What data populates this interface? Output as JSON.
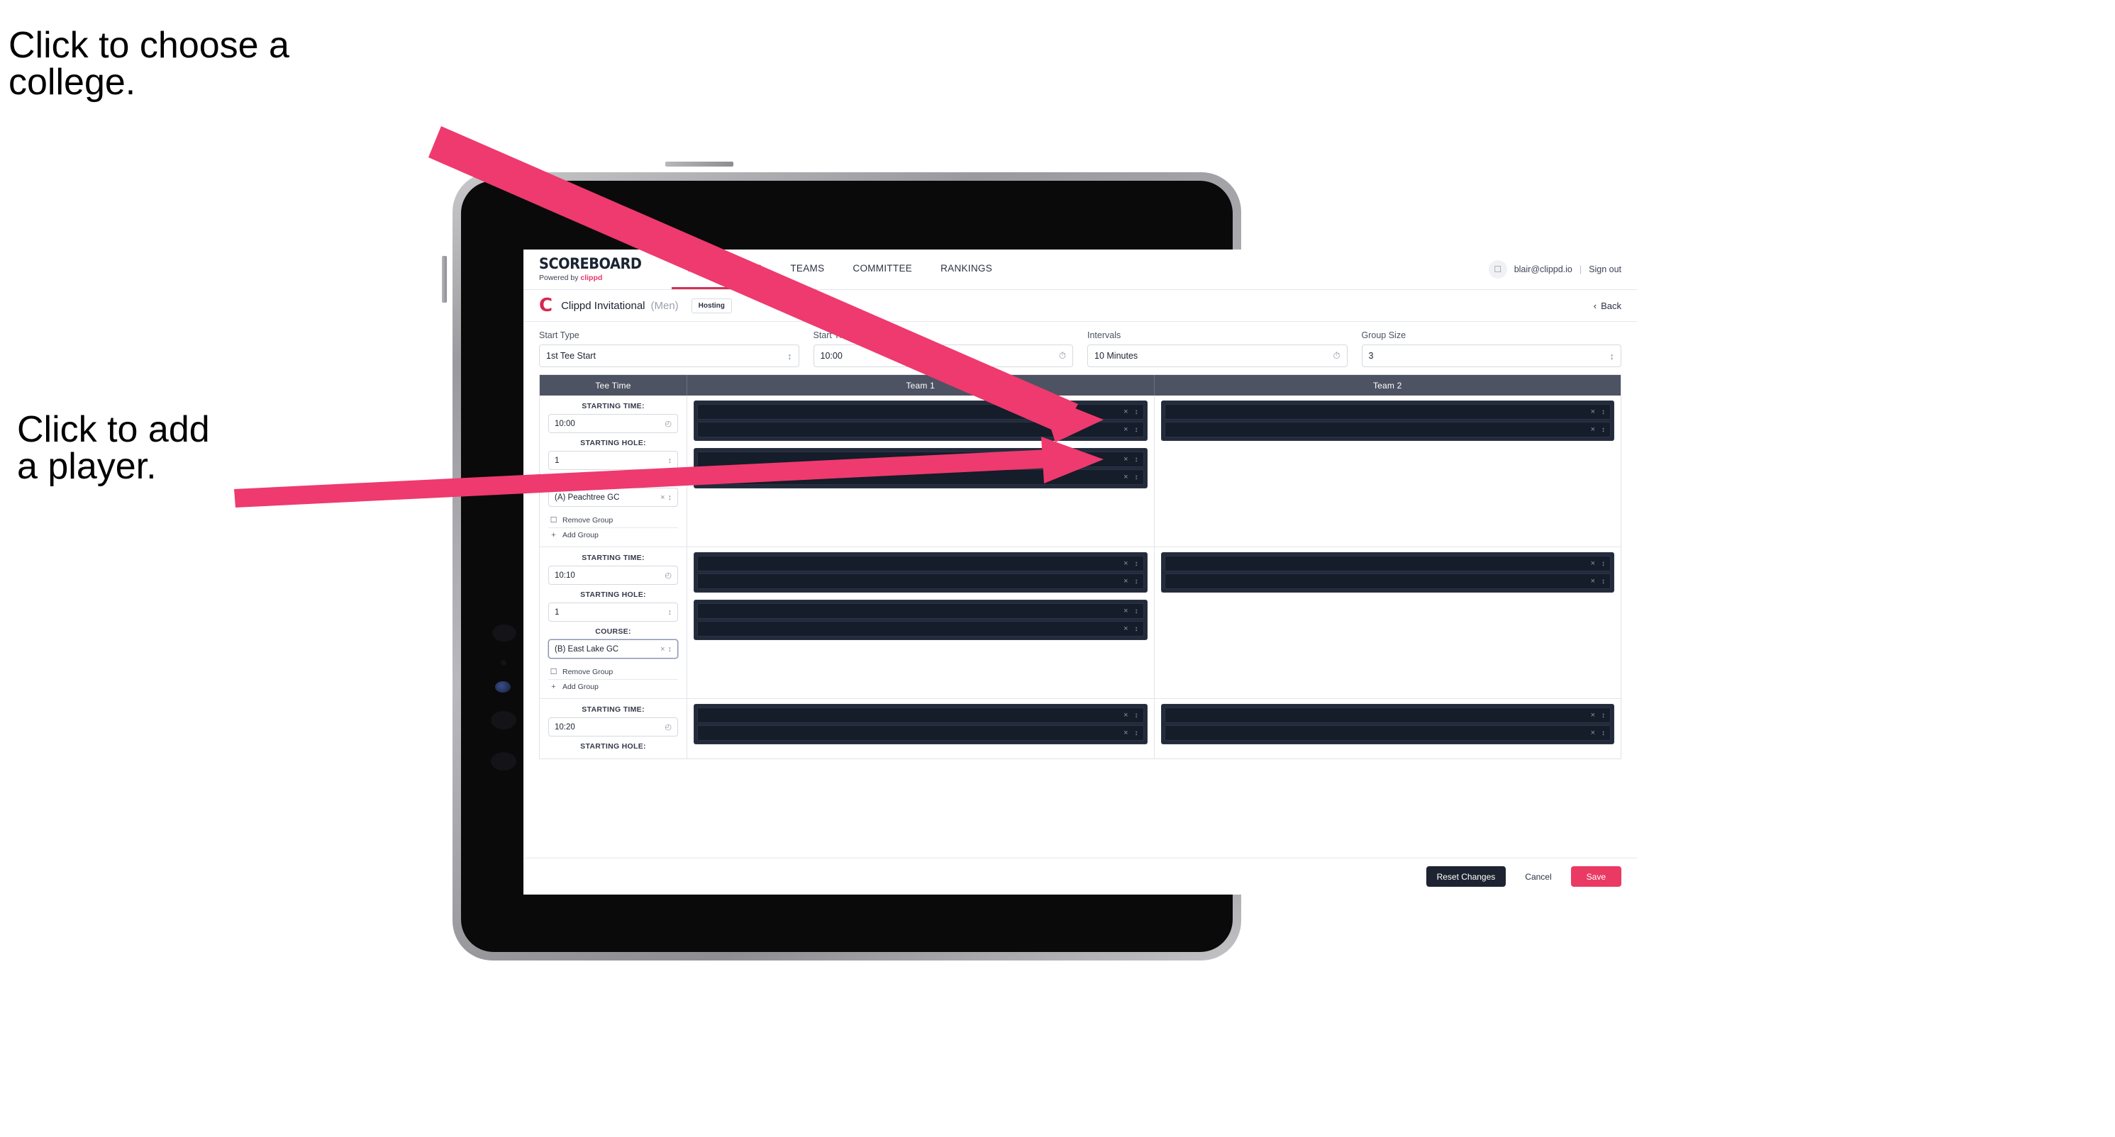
{
  "annotations": {
    "college": "Click to choose a\ncollege.",
    "player": "Click to add\na player."
  },
  "colors": {
    "accent_pink": "#ea3a63",
    "arrow_pink": "#ee3a6e",
    "header_dark": "#4d5362",
    "row_dark": "#232b3b"
  },
  "app": {
    "brand": {
      "title": "SCOREBOARD",
      "powered_prefix": "Powered by ",
      "powered_brand": "clippd"
    },
    "nav": {
      "tabs": [
        "TOURNAMENTS",
        "TEAMS",
        "COMMITTEE",
        "RANKINGS"
      ],
      "active": "TOURNAMENTS"
    },
    "account": {
      "avatar_icon": "user-icon",
      "email": "blair@clippd.io",
      "separator": "|",
      "sign_out": "Sign out"
    },
    "tournament": {
      "logo": "C",
      "name": "Clippd Invitational",
      "gender": "(Men)",
      "status": "Hosting",
      "back": "Back",
      "back_icon": "chevron-left-icon"
    },
    "settings": [
      {
        "label": "Start Type",
        "value": "1st Tee Start",
        "icon": "stepper-icon"
      },
      {
        "label": "Start Time",
        "value": "10:00",
        "icon": "clock-icon"
      },
      {
        "label": "Intervals",
        "value": "10 Minutes",
        "icon": "clock-icon"
      },
      {
        "label": "Group Size",
        "value": "3",
        "icon": "stepper-icon"
      }
    ],
    "table": {
      "columns": [
        "Tee Time",
        "Team 1",
        "Team 2"
      ],
      "labels": {
        "starting_time": "STARTING TIME:",
        "starting_hole": "STARTING HOLE:",
        "course": "COURSE:"
      },
      "actions": {
        "remove": "Remove Group",
        "add": "Add Group",
        "remove_icon": "trash-icon",
        "add_icon": "plus-icon"
      },
      "groups": [
        {
          "starting_time": "10:00",
          "starting_hole": "1",
          "course": "(A) Peachtree GC",
          "course_focused": false,
          "team1": [
            {
              "players": [
                "",
                ""
              ]
            },
            {
              "players": [
                "",
                ""
              ]
            }
          ],
          "team2": [
            {
              "players": [
                "",
                ""
              ]
            }
          ]
        },
        {
          "starting_time": "10:10",
          "starting_hole": "1",
          "course": "(B) East Lake GC",
          "course_focused": true,
          "team1": [
            {
              "players": [
                "",
                ""
              ]
            },
            {
              "players": [
                "",
                ""
              ]
            }
          ],
          "team2": [
            {
              "players": [
                "",
                ""
              ]
            }
          ]
        },
        {
          "starting_time": "10:20",
          "starting_hole": "",
          "course": "",
          "course_focused": false,
          "team1": [
            {
              "players": [
                "",
                ""
              ]
            }
          ],
          "team2": [
            {
              "players": [
                "",
                ""
              ]
            }
          ]
        }
      ]
    },
    "footer": {
      "reset": "Reset Changes",
      "cancel": "Cancel",
      "save": "Save"
    }
  }
}
